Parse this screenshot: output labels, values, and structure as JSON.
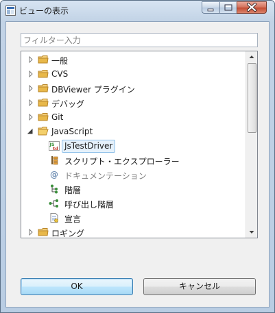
{
  "window": {
    "title": "ビューの表示",
    "controls": [
      "minimize",
      "maximize",
      "close"
    ]
  },
  "filter": {
    "placeholder": "フィルター入力",
    "value": ""
  },
  "tree": {
    "items": [
      {
        "label": "一般",
        "icon": "folder-icon",
        "expander": "collapsed"
      },
      {
        "label": "CVS",
        "icon": "folder-icon",
        "expander": "collapsed"
      },
      {
        "label": "DBViewer プラグイン",
        "icon": "folder-icon",
        "expander": "collapsed"
      },
      {
        "label": "デバッグ",
        "icon": "folder-icon",
        "expander": "collapsed"
      },
      {
        "label": "Git",
        "icon": "folder-icon",
        "expander": "collapsed"
      },
      {
        "label": "JavaScript",
        "icon": "folder-open-icon",
        "expander": "expanded"
      },
      {
        "label": "JsTestDriver",
        "icon": "jstestdriver-icon",
        "selected": true
      },
      {
        "label": "スクリプト・エクスプローラー",
        "icon": "script-explorer-icon"
      },
      {
        "label": "ドキュメンテーション",
        "icon": "at-icon",
        "disabled": true
      },
      {
        "label": "階層",
        "icon": "hierarchy-icon"
      },
      {
        "label": "呼び出し階層",
        "icon": "call-hierarchy-icon"
      },
      {
        "label": "宣言",
        "icon": "declaration-icon"
      },
      {
        "label": "ロギング",
        "icon": "folder-icon",
        "expander": "collapsed"
      }
    ]
  },
  "buttons": {
    "ok_label": "OK",
    "cancel_label": "キャンセル"
  },
  "colors": {
    "selection_bg": "#e5f1fb",
    "selection_border": "#8ec0e8",
    "folder": "#e8b84a",
    "title_bg": "#c2d3e6"
  }
}
